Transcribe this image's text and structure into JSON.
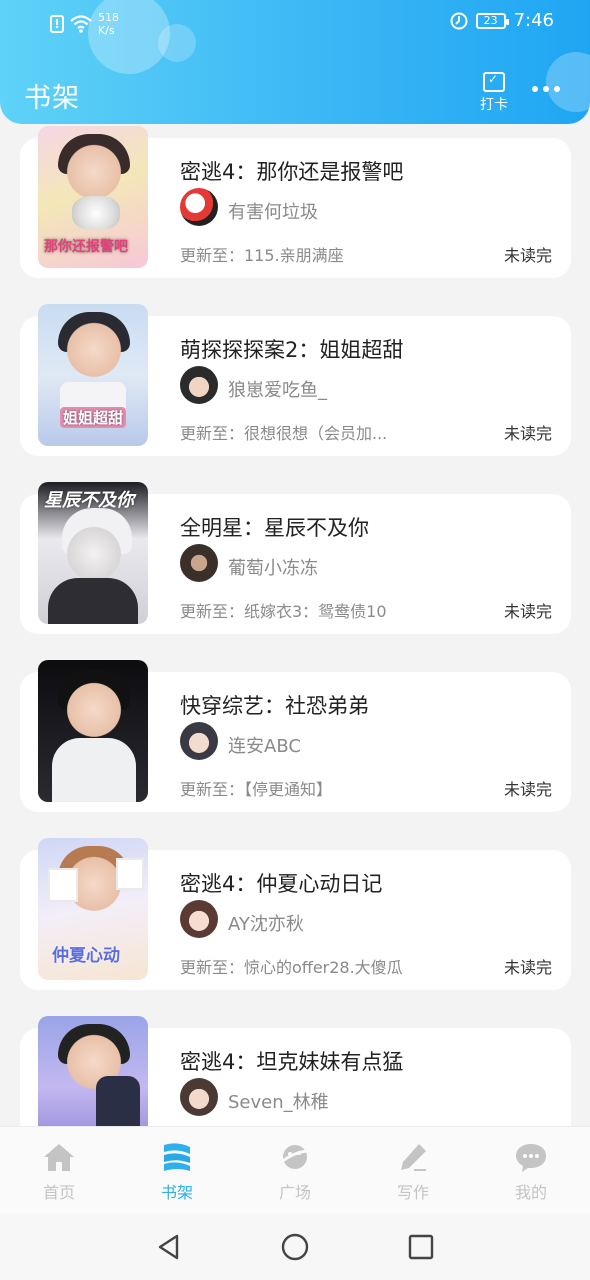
{
  "status_bar": {
    "speed": "518\nK/s",
    "battery": "23",
    "time": "7:46"
  },
  "header": {
    "title": "书架",
    "checkin_label": "打卡"
  },
  "books": [
    {
      "title": "密逃4：那你还是报警吧",
      "author": "有害何垃圾",
      "update": "更新至：115.亲朋满座",
      "status": "未读完",
      "cover_text": "那你还报警吧"
    },
    {
      "title": "萌探探探案2：姐姐超甜",
      "author": "狼崽爱吃鱼_",
      "update": "更新至：很想很想（会员加...",
      "status": "未读完",
      "cover_text": "姐姐超甜"
    },
    {
      "title": "全明星：星辰不及你",
      "author": "葡萄小冻冻",
      "update": "更新至：纸嫁衣3：鸳鸯债10",
      "status": "未读完",
      "cover_text": "星辰不及你"
    },
    {
      "title": "快穿综艺：社恐弟弟",
      "author": "连安ABC",
      "update": "更新至：【停更通知】",
      "status": "未读完",
      "cover_text": ""
    },
    {
      "title": "密逃4：仲夏心动日记",
      "author": "AY沈亦秋",
      "update": "更新至：惊心的offer28.大傻瓜",
      "status": "未读完",
      "cover_text": "仲夏心动"
    },
    {
      "title": "密逃4：坦克妹妹有点猛",
      "author": "Seven_林稚",
      "update": "",
      "status": "",
      "cover_text": ""
    }
  ],
  "tabs": [
    {
      "label": "首页"
    },
    {
      "label": "书架"
    },
    {
      "label": "广场"
    },
    {
      "label": "写作"
    },
    {
      "label": "我的"
    }
  ],
  "colors": {
    "accent": "#2fb0ec",
    "header_start": "#5fd2f7",
    "header_end": "#1fa6f3",
    "inactive": "#c4c4c4"
  }
}
